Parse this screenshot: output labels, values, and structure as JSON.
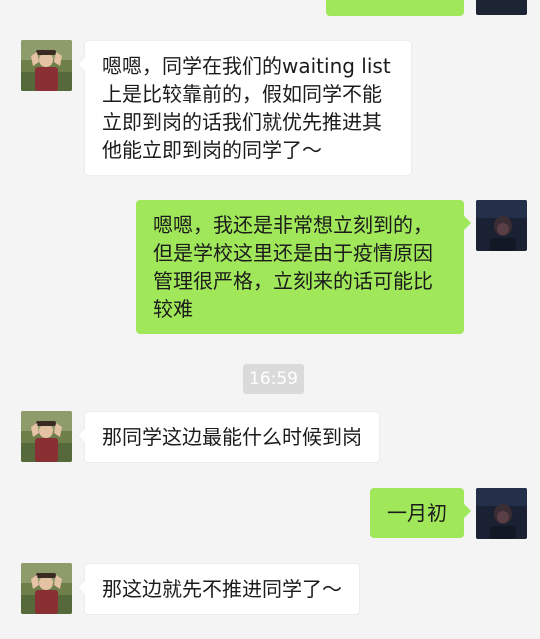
{
  "chat": {
    "messages": [
      {
        "sender": "other",
        "text": "嗯嗯，同学在我们的waiting list上是比较靠前的，假如同学不能立即到岗的话我们就优先推进其他能立即到岗的同学了～"
      },
      {
        "sender": "me",
        "text": "嗯嗯，我还是非常想立刻到的，但是学校这里还是由于疫情原因管理很严格，立刻来的话可能比较难"
      },
      {
        "sender": "other",
        "text": "那同学这边最能什么时候到岗"
      },
      {
        "sender": "me",
        "text": "一月初"
      },
      {
        "sender": "other",
        "text": "那这边就先不推进同学了～"
      }
    ],
    "timestamp": "16:59"
  },
  "colors": {
    "background": "#f4f4f4",
    "incoming_bubble": "#ffffff",
    "outgoing_bubble": "#a0e75a",
    "timestamp_bg": "#dadada"
  },
  "icons": {
    "other_avatar": "photo-avatar-person",
    "my_avatar": "photo-avatar-dark"
  }
}
